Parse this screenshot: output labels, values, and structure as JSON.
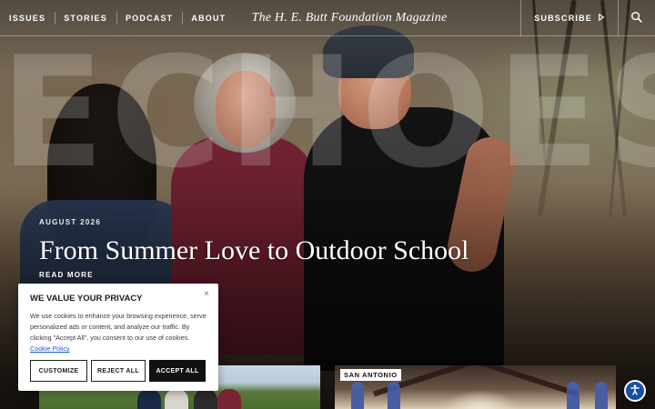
{
  "nav": {
    "items": [
      {
        "label": "ISSUES"
      },
      {
        "label": "STORIES"
      },
      {
        "label": "PODCAST"
      },
      {
        "label": "ABOUT"
      }
    ],
    "brand": "The H. E. Butt Foundation Magazine",
    "subscribe_label": "SUBSCRIBE",
    "icons": {
      "subscribe_arrow": "play-arrow-icon",
      "search": "search-icon"
    }
  },
  "hero": {
    "watermark": "ECHOES",
    "kicker": "AUGUST 2026",
    "headline": "From Summer Love to Outdoor School",
    "read_more": "READ MORE"
  },
  "cards": [
    {
      "tag": ""
    },
    {
      "tag": "SAN ANTONIO"
    }
  ],
  "cookie": {
    "title": "WE VALUE YOUR PRIVACY",
    "body": "We use cookies to enhance your browsing experience, serve personalized ads or content, and analyze our traffic. By clicking \"Accept All\", you consent to our use of cookies.",
    "link": "Cookie Policy",
    "buttons": {
      "customize": "CUSTOMIZE",
      "reject": "REJECT ALL",
      "accept": "ACCEPT ALL"
    },
    "close_icon": "close-icon"
  },
  "accessibility": {
    "icon": "accessibility-icon"
  },
  "colors": {
    "accent_blue": "#1c4fa3",
    "link_blue": "#1c57d6",
    "cookie_accept_bg": "#111111"
  }
}
